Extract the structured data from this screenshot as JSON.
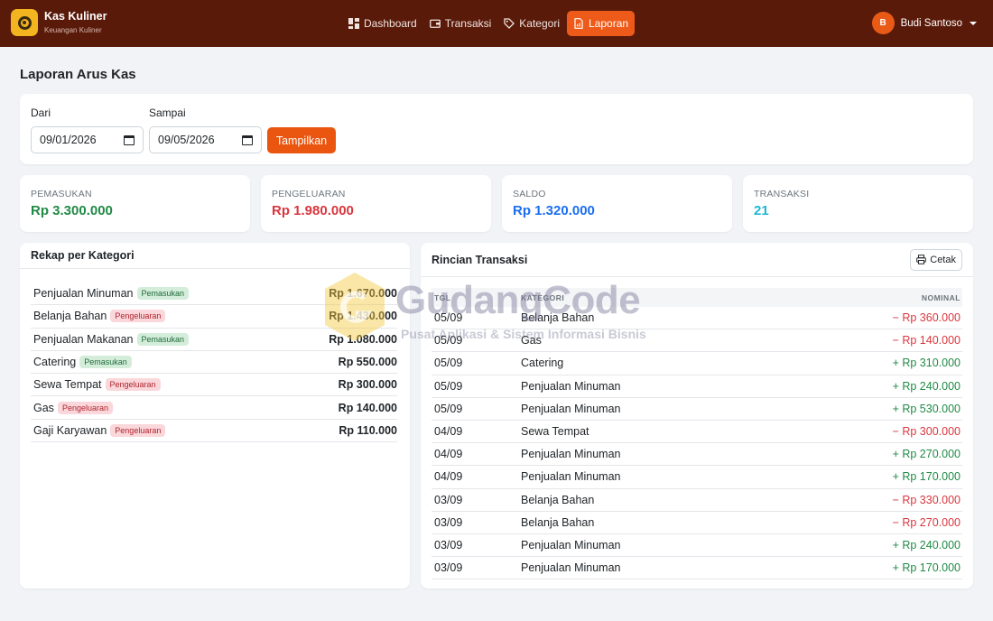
{
  "app": {
    "title": "Kas Kuliner",
    "subtitle": "Keuangan Kuliner"
  },
  "nav": [
    {
      "label": "Dashboard",
      "icon": "dashboard-icon"
    },
    {
      "label": "Transaksi",
      "icon": "wallet-icon"
    },
    {
      "label": "Kategori",
      "icon": "tag-icon"
    },
    {
      "label": "Laporan",
      "icon": "report-icon",
      "active": true
    }
  ],
  "user": {
    "initial": "B",
    "name": "Budi Santoso"
  },
  "page": {
    "title": "Laporan Arus Kas"
  },
  "filter": {
    "from_label": "Dari",
    "from_value": "09/01/2026",
    "to_label": "Sampai",
    "to_value": "09/05/2026",
    "submit_label": "Tampilkan"
  },
  "stats": [
    {
      "label": "PEMASUKAN",
      "value": "Rp 3.300.000",
      "color": "#218a46"
    },
    {
      "label": "PENGELUARAN",
      "value": "Rp 1.980.000",
      "color": "#d9363e"
    },
    {
      "label": "SALDO",
      "value": "Rp 1.320.000",
      "color": "#1b6ff0"
    },
    {
      "label": "TRANSAKSI",
      "value": "21",
      "color": "#1fb6d6"
    }
  ],
  "rekap": {
    "title": "Rekap per Kategori",
    "rows": [
      {
        "name": "Penjualan Minuman",
        "type": "Pemasukan",
        "amount": "Rp 1.670.000"
      },
      {
        "name": "Belanja Bahan",
        "type": "Pengeluaran",
        "amount": "Rp 1.430.000"
      },
      {
        "name": "Penjualan Makanan",
        "type": "Pemasukan",
        "amount": "Rp 1.080.000"
      },
      {
        "name": "Catering",
        "type": "Pemasukan",
        "amount": "Rp 550.000"
      },
      {
        "name": "Sewa Tempat",
        "type": "Pengeluaran",
        "amount": "Rp 300.000"
      },
      {
        "name": "Gas",
        "type": "Pengeluaran",
        "amount": "Rp 140.000"
      },
      {
        "name": "Gaji Karyawan",
        "type": "Pengeluaran",
        "amount": "Rp 110.000"
      }
    ]
  },
  "rincian": {
    "title": "Rincian Transaksi",
    "print_label": "Cetak",
    "columns": [
      "TGL",
      "KATEGORI",
      "NOMINAL"
    ],
    "rows": [
      {
        "date": "05/09",
        "category": "Belanja Bahan",
        "amount": "− Rp 360.000",
        "sign": "neg"
      },
      {
        "date": "05/09",
        "category": "Gas",
        "amount": "− Rp 140.000",
        "sign": "neg"
      },
      {
        "date": "05/09",
        "category": "Catering",
        "amount": "+ Rp 310.000",
        "sign": "pos"
      },
      {
        "date": "05/09",
        "category": "Penjualan Minuman",
        "amount": "+ Rp 240.000",
        "sign": "pos"
      },
      {
        "date": "05/09",
        "category": "Penjualan Minuman",
        "amount": "+ Rp 530.000",
        "sign": "pos"
      },
      {
        "date": "04/09",
        "category": "Sewa Tempat",
        "amount": "− Rp 300.000",
        "sign": "neg"
      },
      {
        "date": "04/09",
        "category": "Penjualan Minuman",
        "amount": "+ Rp 270.000",
        "sign": "pos"
      },
      {
        "date": "04/09",
        "category": "Penjualan Minuman",
        "amount": "+ Rp 170.000",
        "sign": "pos"
      },
      {
        "date": "03/09",
        "category": "Belanja Bahan",
        "amount": "− Rp 330.000",
        "sign": "neg"
      },
      {
        "date": "03/09",
        "category": "Belanja Bahan",
        "amount": "− Rp 270.000",
        "sign": "neg"
      },
      {
        "date": "03/09",
        "category": "Penjualan Minuman",
        "amount": "+ Rp 240.000",
        "sign": "pos"
      },
      {
        "date": "03/09",
        "category": "Penjualan Minuman",
        "amount": "+ Rp 170.000",
        "sign": "pos"
      }
    ]
  },
  "watermark": {
    "title": "GudangCode",
    "subtitle": "Pusat Aplikasi & Sistem Informasi Bisnis"
  }
}
